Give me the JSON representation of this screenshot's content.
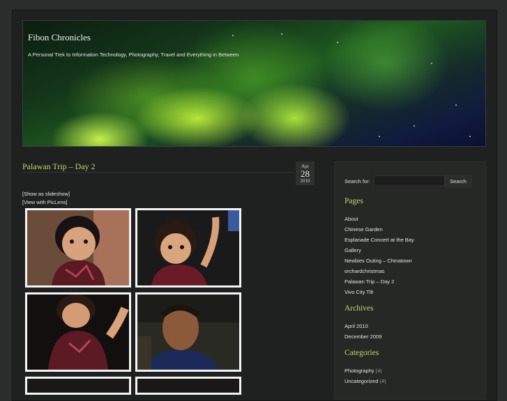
{
  "site": {
    "title": "Fibon Chronicles",
    "description": "A Personal Trek to Information Technology, Photography, Travel and Everything in Between"
  },
  "post": {
    "title": "Palawan Trip – Day 2",
    "date": {
      "month": "Apr",
      "day": "28",
      "year": "2010"
    },
    "links": {
      "slideshow": "[Show as slideshow]",
      "piclens": "[View with PicLens]"
    }
  },
  "sidebar": {
    "search": {
      "label": "Search for:",
      "value": "",
      "button": "Search"
    },
    "pages": {
      "title": "Pages",
      "items": [
        "About",
        "Chinese Garden",
        "Esplanade Concert at the Bay",
        "Gallery",
        "Newbies Outing – Chinatown",
        "orchardchristmas",
        "Palawan Trip – Day 2",
        "Vivo City Tilt"
      ]
    },
    "archives": {
      "title": "Archives",
      "items": [
        "April 2010",
        "December 2009"
      ]
    },
    "categories": {
      "title": "Categories",
      "items": [
        {
          "name": "Photography",
          "count": "(4)"
        },
        {
          "name": "Uncategorized",
          "count": "(4)"
        }
      ]
    }
  },
  "colors": {
    "accent": "#c7d36e",
    "background": "#1f2120",
    "text": "#e4e4e4"
  }
}
